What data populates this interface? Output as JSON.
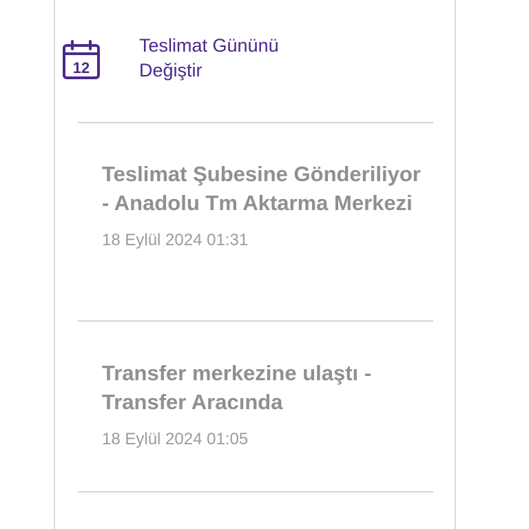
{
  "action": {
    "label_line1": "Teslimat Gününü",
    "label_line2": "Değiştir",
    "icon": "calendar-icon",
    "calendar_day": "12",
    "accent_color": "#4b2a8a"
  },
  "events": [
    {
      "title": "Teslimat Şubesine Gönderiliyor - Anadolu Tm Aktarma Merkezi",
      "time": "18 Eylül 2024 01:31"
    },
    {
      "title": "Transfer merkezine ulaştı - Transfer Aracında",
      "time": "18 Eylül 2024 01:05"
    }
  ]
}
